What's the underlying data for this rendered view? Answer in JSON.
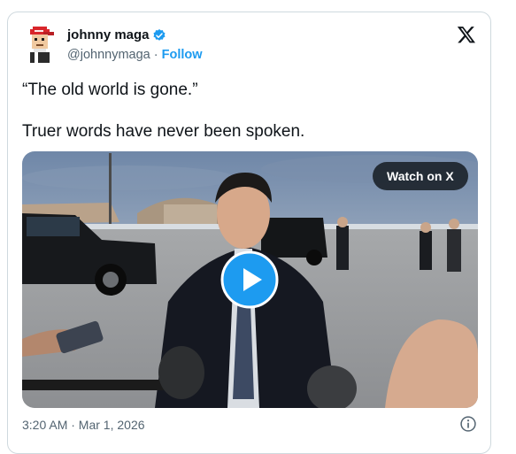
{
  "author": {
    "name": "johnny maga",
    "handle": "@johnnymaga",
    "separator": " · ",
    "follow_label": "Follow",
    "verified_color": "#1d9bf0"
  },
  "tweet": {
    "line1": "“The old world is gone.”",
    "line2": "Truer words have never been spoken."
  },
  "media": {
    "watch_label": "Watch on X",
    "play_button_color": "#1d9bf0"
  },
  "footer": {
    "timestamp": "3:20 AM · Mar 1, 2026"
  },
  "icons": {
    "x_logo": "x-logo-icon",
    "verified": "verified-badge-icon",
    "play": "play-icon",
    "info": "info-icon"
  }
}
